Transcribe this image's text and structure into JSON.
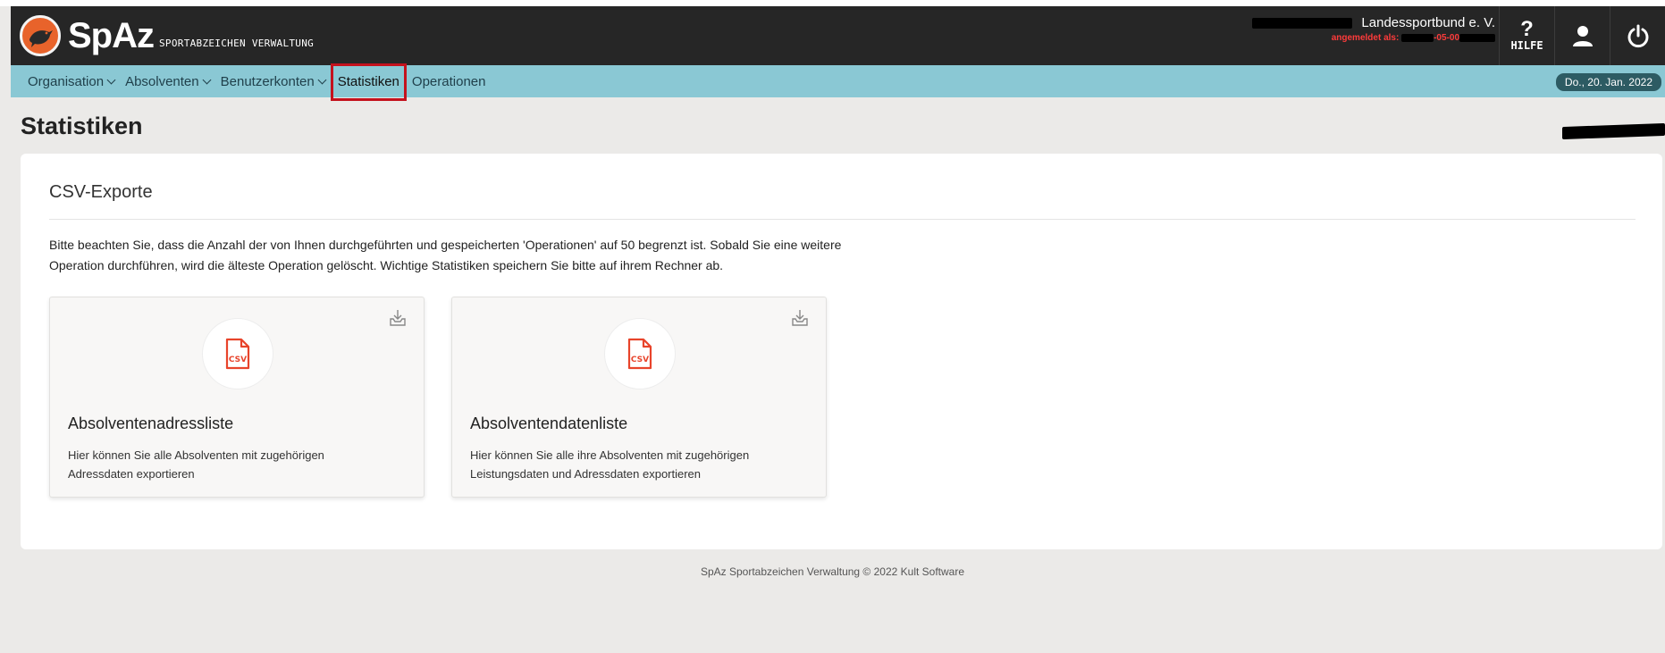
{
  "header": {
    "logo_text": "SpAz",
    "logo_subtitle": "SPORTABZEICHEN VERWALTUNG",
    "org_name": "Landessportbund e. V.",
    "login_label": "angemeldet als:",
    "login_user_suffix": "-05-00",
    "help_label": "HILFE",
    "brand_color": "#e8632b"
  },
  "nav": {
    "items": [
      {
        "label": "Organisation",
        "dropdown": true
      },
      {
        "label": "Absolventen",
        "dropdown": true
      },
      {
        "label": "Benutzerkonten",
        "dropdown": true
      },
      {
        "label": "Statistiken",
        "dropdown": false,
        "active": true
      },
      {
        "label": "Operationen",
        "dropdown": false
      }
    ],
    "date": "Do., 20. Jan. 2022"
  },
  "page": {
    "title": "Statistiken"
  },
  "exports": {
    "heading": "CSV-Exporte",
    "notice_line1": "Bitte beachten Sie, dass die Anzahl der von Ihnen durchgeführten und gespeicherten 'Operationen' auf 50 begrenzt ist. Sobald Sie eine weitere",
    "notice_line2": "Operation durchführen, wird die älteste Operation gelöscht. Wichtige Statistiken speichern Sie bitte auf ihrem Rechner ab.",
    "cards": [
      {
        "title": "Absolventenadressliste",
        "desc_line1": "Hier können Sie alle Absolventen mit zugehörigen",
        "desc_line2": "Adressdaten exportieren",
        "icon": "csv-file-icon"
      },
      {
        "title": "Absolventendatenliste",
        "desc_line1": "Hier können Sie alle ihre Absolventen mit zugehörigen",
        "desc_line2": "Leistungsdaten und Adressdaten exportieren",
        "icon": "csv-file-icon"
      }
    ],
    "csv_label": "CSV",
    "csv_color": "#e8442b"
  },
  "footer": {
    "text": "SpAz Sportabzeichen Verwaltung © 2022 Kult Software"
  }
}
